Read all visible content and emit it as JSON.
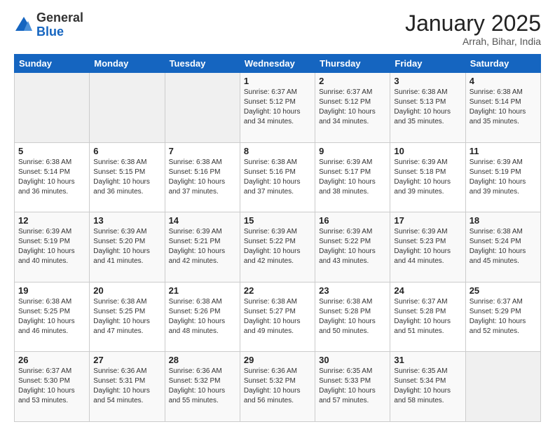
{
  "logo": {
    "general": "General",
    "blue": "Blue"
  },
  "header": {
    "month": "January 2025",
    "location": "Arrah, Bihar, India"
  },
  "weekdays": [
    "Sunday",
    "Monday",
    "Tuesday",
    "Wednesday",
    "Thursday",
    "Friday",
    "Saturday"
  ],
  "weeks": [
    [
      {
        "day": "",
        "info": ""
      },
      {
        "day": "",
        "info": ""
      },
      {
        "day": "",
        "info": ""
      },
      {
        "day": "1",
        "info": "Sunrise: 6:37 AM\nSunset: 5:12 PM\nDaylight: 10 hours\nand 34 minutes."
      },
      {
        "day": "2",
        "info": "Sunrise: 6:37 AM\nSunset: 5:12 PM\nDaylight: 10 hours\nand 34 minutes."
      },
      {
        "day": "3",
        "info": "Sunrise: 6:38 AM\nSunset: 5:13 PM\nDaylight: 10 hours\nand 35 minutes."
      },
      {
        "day": "4",
        "info": "Sunrise: 6:38 AM\nSunset: 5:14 PM\nDaylight: 10 hours\nand 35 minutes."
      }
    ],
    [
      {
        "day": "5",
        "info": "Sunrise: 6:38 AM\nSunset: 5:14 PM\nDaylight: 10 hours\nand 36 minutes."
      },
      {
        "day": "6",
        "info": "Sunrise: 6:38 AM\nSunset: 5:15 PM\nDaylight: 10 hours\nand 36 minutes."
      },
      {
        "day": "7",
        "info": "Sunrise: 6:38 AM\nSunset: 5:16 PM\nDaylight: 10 hours\nand 37 minutes."
      },
      {
        "day": "8",
        "info": "Sunrise: 6:38 AM\nSunset: 5:16 PM\nDaylight: 10 hours\nand 37 minutes."
      },
      {
        "day": "9",
        "info": "Sunrise: 6:39 AM\nSunset: 5:17 PM\nDaylight: 10 hours\nand 38 minutes."
      },
      {
        "day": "10",
        "info": "Sunrise: 6:39 AM\nSunset: 5:18 PM\nDaylight: 10 hours\nand 39 minutes."
      },
      {
        "day": "11",
        "info": "Sunrise: 6:39 AM\nSunset: 5:19 PM\nDaylight: 10 hours\nand 39 minutes."
      }
    ],
    [
      {
        "day": "12",
        "info": "Sunrise: 6:39 AM\nSunset: 5:19 PM\nDaylight: 10 hours\nand 40 minutes."
      },
      {
        "day": "13",
        "info": "Sunrise: 6:39 AM\nSunset: 5:20 PM\nDaylight: 10 hours\nand 41 minutes."
      },
      {
        "day": "14",
        "info": "Sunrise: 6:39 AM\nSunset: 5:21 PM\nDaylight: 10 hours\nand 42 minutes."
      },
      {
        "day": "15",
        "info": "Sunrise: 6:39 AM\nSunset: 5:22 PM\nDaylight: 10 hours\nand 42 minutes."
      },
      {
        "day": "16",
        "info": "Sunrise: 6:39 AM\nSunset: 5:22 PM\nDaylight: 10 hours\nand 43 minutes."
      },
      {
        "day": "17",
        "info": "Sunrise: 6:39 AM\nSunset: 5:23 PM\nDaylight: 10 hours\nand 44 minutes."
      },
      {
        "day": "18",
        "info": "Sunrise: 6:38 AM\nSunset: 5:24 PM\nDaylight: 10 hours\nand 45 minutes."
      }
    ],
    [
      {
        "day": "19",
        "info": "Sunrise: 6:38 AM\nSunset: 5:25 PM\nDaylight: 10 hours\nand 46 minutes."
      },
      {
        "day": "20",
        "info": "Sunrise: 6:38 AM\nSunset: 5:25 PM\nDaylight: 10 hours\nand 47 minutes."
      },
      {
        "day": "21",
        "info": "Sunrise: 6:38 AM\nSunset: 5:26 PM\nDaylight: 10 hours\nand 48 minutes."
      },
      {
        "day": "22",
        "info": "Sunrise: 6:38 AM\nSunset: 5:27 PM\nDaylight: 10 hours\nand 49 minutes."
      },
      {
        "day": "23",
        "info": "Sunrise: 6:38 AM\nSunset: 5:28 PM\nDaylight: 10 hours\nand 50 minutes."
      },
      {
        "day": "24",
        "info": "Sunrise: 6:37 AM\nSunset: 5:28 PM\nDaylight: 10 hours\nand 51 minutes."
      },
      {
        "day": "25",
        "info": "Sunrise: 6:37 AM\nSunset: 5:29 PM\nDaylight: 10 hours\nand 52 minutes."
      }
    ],
    [
      {
        "day": "26",
        "info": "Sunrise: 6:37 AM\nSunset: 5:30 PM\nDaylight: 10 hours\nand 53 minutes."
      },
      {
        "day": "27",
        "info": "Sunrise: 6:36 AM\nSunset: 5:31 PM\nDaylight: 10 hours\nand 54 minutes."
      },
      {
        "day": "28",
        "info": "Sunrise: 6:36 AM\nSunset: 5:32 PM\nDaylight: 10 hours\nand 55 minutes."
      },
      {
        "day": "29",
        "info": "Sunrise: 6:36 AM\nSunset: 5:32 PM\nDaylight: 10 hours\nand 56 minutes."
      },
      {
        "day": "30",
        "info": "Sunrise: 6:35 AM\nSunset: 5:33 PM\nDaylight: 10 hours\nand 57 minutes."
      },
      {
        "day": "31",
        "info": "Sunrise: 6:35 AM\nSunset: 5:34 PM\nDaylight: 10 hours\nand 58 minutes."
      },
      {
        "day": "",
        "info": ""
      }
    ]
  ]
}
